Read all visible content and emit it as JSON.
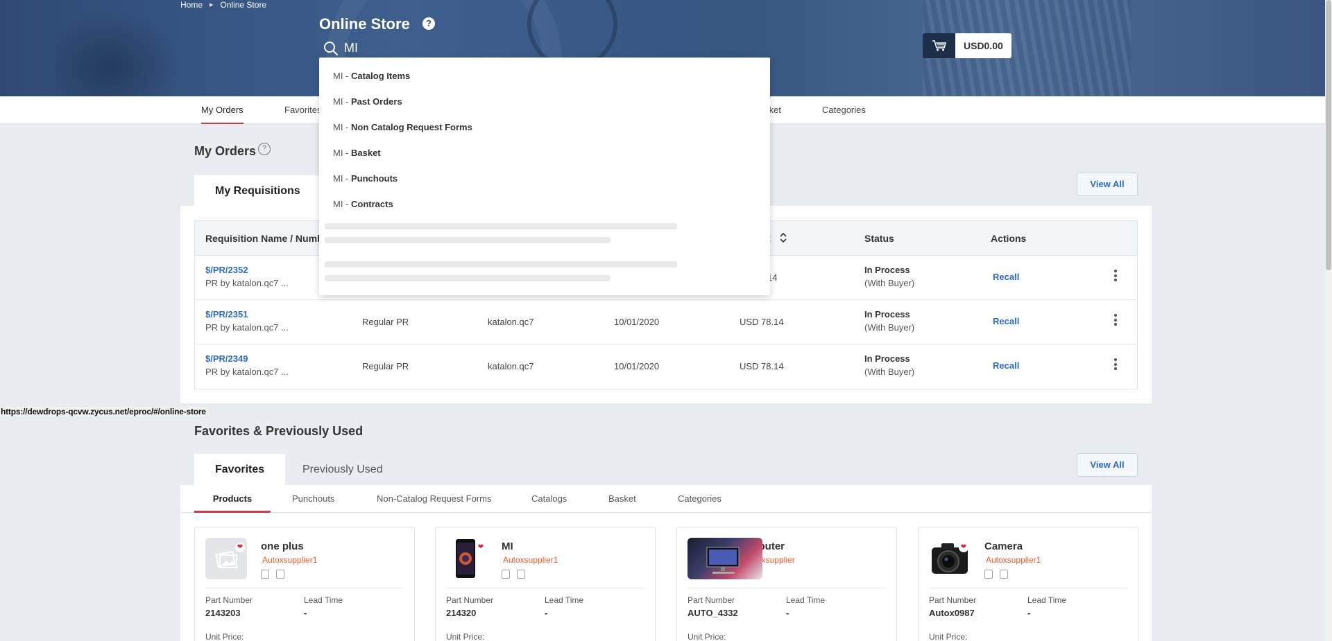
{
  "breadcrumb": {
    "home": "Home",
    "current": "Online Store"
  },
  "header": {
    "title": "Online Store",
    "help": "?",
    "search_value": "MI"
  },
  "cart": {
    "amount": "USD0.00"
  },
  "topnav": {
    "tabs": [
      "My Orders",
      "Favorites",
      "Basket",
      "Categories"
    ]
  },
  "my_orders": {
    "title": "My Orders",
    "tabs": [
      "My Requisitions"
    ],
    "view_all": "View All",
    "columns": [
      "Requisition Name / Number",
      "Status",
      "Actions"
    ],
    "amount_col_partial": "t",
    "first_row_amount_partial": "14",
    "rows": [
      {
        "id": "$/PR/2352",
        "desc": "PR by katalon.qc7 ...",
        "type": "",
        "user": "",
        "date": "",
        "amount": "",
        "status": "In Process",
        "status_sub": "(With Buyer)",
        "action": "Recall"
      },
      {
        "id": "$/PR/2351",
        "desc": "PR by katalon.qc7 ...",
        "type": "Regular PR",
        "user": "katalon.qc7",
        "date": "10/01/2020",
        "amount": "USD 78.14",
        "status": "In Process",
        "status_sub": "(With Buyer)",
        "action": "Recall"
      },
      {
        "id": "$/PR/2349",
        "desc": "PR by katalon.qc7 ...",
        "type": "Regular PR",
        "user": "katalon.qc7",
        "date": "10/01/2020",
        "amount": "USD 78.14",
        "status": "In Process",
        "status_sub": "(With Buyer)",
        "action": "Recall"
      }
    ]
  },
  "status_url": "https://dewdrops-qcvw.zycus.net/eproc/#/online-store",
  "favorites": {
    "title": "Favorites & Previously Used",
    "tabs": [
      "Favorites",
      "Previously Used"
    ],
    "view_all": "View All",
    "subtabs": [
      "Products",
      "Punchouts",
      "Non-Catalog Request Forms",
      "Catalogs",
      "Basket",
      "Categories"
    ],
    "cards": [
      {
        "name": "one plus",
        "supplier": "Autoxsupplier1",
        "part_label": "Part Number",
        "part": "2143203",
        "lead_label": "Lead Time",
        "lead": "-",
        "price_label": "Unit Price:"
      },
      {
        "name": "MI",
        "supplier": "Autoxsupplier1",
        "part_label": "Part Number",
        "part": "214320",
        "lead_label": "Lead Time",
        "lead": "-",
        "price_label": "Unit Price:"
      },
      {
        "name": "omputer",
        "supplier": "Autoxsupplier",
        "part_label": "Part Number",
        "part": "AUTO_4332",
        "lead_label": "Lead Time",
        "lead": "-",
        "price_label": "Unit Price:"
      },
      {
        "name": "Camera",
        "supplier": "Autoxsupplier1",
        "part_label": "Part Number",
        "part": "Autox0987",
        "lead_label": "Lead Time",
        "lead": "-",
        "price_label": "Unit Price:"
      }
    ]
  },
  "search_dropdown": {
    "prefix": "MI - ",
    "items": [
      "Catalog Items",
      "Past Orders",
      "Non Catalog Request Forms",
      "Basket",
      "Punchouts",
      "Contracts"
    ]
  }
}
